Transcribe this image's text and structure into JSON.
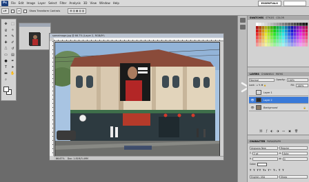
{
  "menubar": {
    "app_logo": "Ps",
    "items": [
      "File",
      "Edit",
      "Image",
      "Layer",
      "Select",
      "Filter",
      "Analysis",
      "3D",
      "View",
      "Window",
      "Help"
    ],
    "workspace_label": "ESSENTIALS"
  },
  "options": {
    "tool_label": "Show Transform Controls"
  },
  "document": {
    "title": "someimage.jpg @ 66.7% (Layer 2, RGB/8*)",
    "status": "Doc: 1.81M/3.49M",
    "zoom": "66.67%"
  },
  "panels": {
    "color_tabs": [
      "SWATCHES",
      "STYLES",
      "COLOR"
    ],
    "layers_tabs": [
      "LAYERS",
      "CHANNELS",
      "PATHS"
    ],
    "blend_mode": "Normal",
    "opacity_label": "Opacity:",
    "opacity_value": "100%",
    "lock_label": "Lock:",
    "fill_label": "Fill:",
    "fill_value": "100%",
    "layers": [
      {
        "name": "Layer 1",
        "selected": false
      },
      {
        "name": "Layer 2",
        "selected": true
      },
      {
        "name": "Background",
        "selected": false
      }
    ],
    "char_tabs": [
      "CHARACTER",
      "PARAGRAPH"
    ],
    "font_family": "Angsana New",
    "font_style": "Regular",
    "font_size": "2 pt",
    "leading": "Auto",
    "tracking": "0",
    "color_label": "Color:",
    "language": "English: USA",
    "aa": "Sharp"
  },
  "colors": {
    "selected_layer": "#3a7ad9",
    "app_bg": "#6b6b6b"
  }
}
